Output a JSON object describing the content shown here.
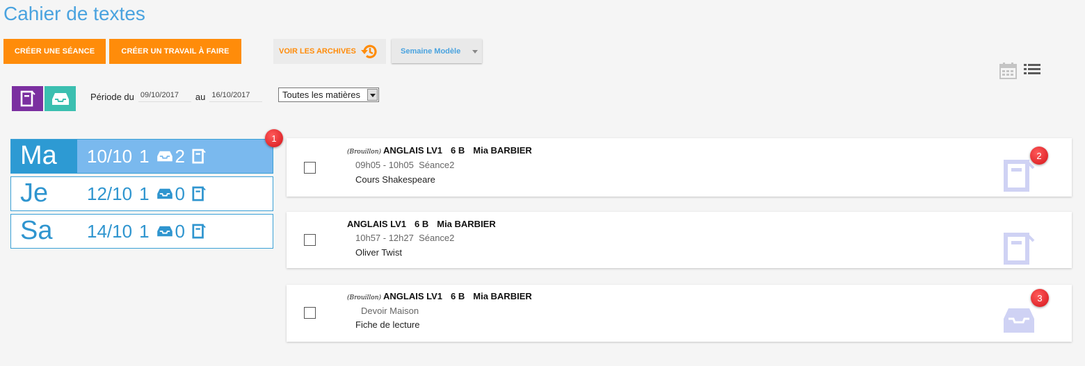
{
  "page": {
    "title": "Cahier de textes"
  },
  "toolbar": {
    "create_session": "CRÉER UNE SÉANCE",
    "create_homework": "CRÉER UN TRAVAIL À FAIRE",
    "archives": "VOIR LES ARCHIVES",
    "week_model": "Semaine Modèle"
  },
  "view_icons": [
    "calendar-icon",
    "list-icon"
  ],
  "filters": {
    "period_label": "Période du",
    "from": "09/10/2017",
    "to_label": "au",
    "to": "16/10/2017",
    "subject": "Toutes les matières"
  },
  "colors": {
    "accent": "#4aa3df",
    "orange": "#ff8c0a",
    "purple": "#7b2fa0",
    "teal": "#3bbfb0",
    "icon_light": "#cfd2f4"
  },
  "days": [
    {
      "name": "Ma",
      "date": "10/10",
      "sessions": "1",
      "homework": "2",
      "active": true,
      "badge": "1"
    },
    {
      "name": "Je",
      "date": "12/10",
      "sessions": "1",
      "homework": "0",
      "active": false
    },
    {
      "name": "Sa",
      "date": "14/10",
      "sessions": "1",
      "homework": "0",
      "active": false
    }
  ],
  "entries": [
    {
      "draft": "(Brouillon)",
      "subject": "ANGLAIS LV1",
      "class": "6 B",
      "teacher": "Mia BARBIER",
      "time": "09h05 - 10h05  Séance2",
      "content": "Cours Shakespeare",
      "kind": "session",
      "badge": "2"
    },
    {
      "draft": "",
      "subject": "ANGLAIS LV1",
      "class": "6 B",
      "teacher": "Mia BARBIER",
      "time": "10h57 - 12h27  Séance2",
      "content": "Oliver Twist",
      "kind": "session"
    },
    {
      "draft": "(Brouillon)",
      "subject": "ANGLAIS LV1",
      "class": "6 B",
      "teacher": "Mia BARBIER",
      "time": "Devoir Maison",
      "content": "Fiche de lecture",
      "kind": "homework",
      "badge": "3"
    }
  ]
}
